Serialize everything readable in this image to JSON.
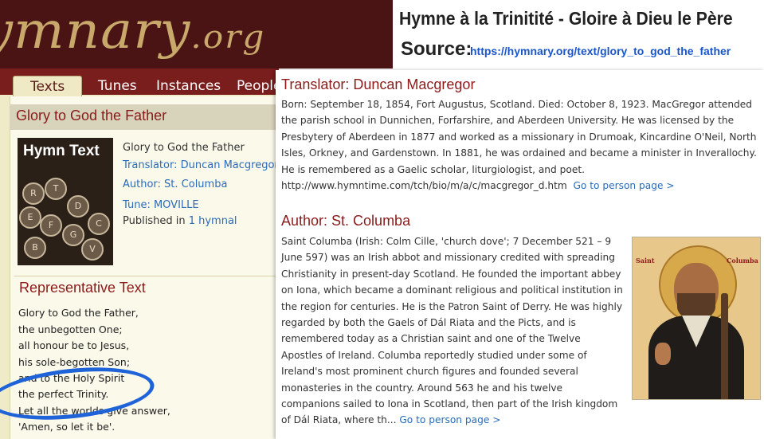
{
  "site": {
    "logo_main": "ymnary",
    "logo_suffix": ".org",
    "tabs": [
      "Texts",
      "Tunes",
      "Instances",
      "People"
    ]
  },
  "hymn": {
    "page_title": "Glory to God the Father",
    "image_caption": "Hymn Text",
    "image_keys": [
      "R",
      "T",
      "E",
      "D",
      "F",
      "G",
      "C",
      "V",
      "B"
    ],
    "info_title": "Glory to God the Father",
    "translator": "Translator: Duncan Macgregor",
    "author": "Author: St. Columba",
    "tune": "Tune: MOVILLE",
    "published_prefix": "Published in",
    "published_link": "1 hymnal"
  },
  "representative": {
    "heading": "Representative Text",
    "lines": [
      "Glory to God the Father,",
      "the unbegotten One;",
      "all honour be to Jesus,",
      "his sole-begotten Son;",
      "and to the Holy Spirit",
      "the perfect Trinity.",
      "Let all the worlds give answer,",
      "'Amen, so let it be'."
    ]
  },
  "caption": {
    "title": "Hymne à la Trinitité - Gloire à Dieu le Père",
    "source_label": "Source:",
    "source_url": "https://hymnary.org/text/glory_to_god_the_father"
  },
  "translator_bio": {
    "heading": "Translator: Duncan Macgregor",
    "text": "Born: September 18, 1854, Fort Augustus, Scotland. Died: October 8, 1923. MacGregor attended the parish school in Dunnichen, Forfarshire, and Aberdeen University. He was licensed by the Presbytery of Aberdeen in 1877 and worked as a missionary in Drumoak, Kincardine O'Neil, North Isles, Orkney, and Gardenstown. In 1881, he was ordained and became a minister in Inverallochy. He is remembered as a Gaelic scholar, liturgiologist, and poet. http://www.hymntime.com/tch/bio/m/a/c/macgregor_d.htm",
    "link": "Go to person page >"
  },
  "author_bio": {
    "heading": "Author: St. Columba",
    "text": "Saint Columba (Irish: Colm Cille, 'church dove'; 7 December 521 – 9 June 597) was an Irish abbot and missionary credited with spreading Christianity in present-day Scotland. He founded the important abbey on Iona, which became a dominant religious and political institution in the region for centuries. He is the Patron Saint of Derry. He was highly regarded by both the Gaels of Dál Riata and the Picts, and is remembered today as a Christian saint and one of the Twelve Apostles of Ireland. Columba reportedly studied under some of Ireland's most prominent church figures and founded several monasteries in the country. Around 563 he and his twelve companions sailed to Iona in Scotland, then part of the Irish kingdom of Dál Riata, where th...",
    "link": "Go to person page >",
    "icon_label_left": "Saint",
    "icon_label_right": "Columba"
  },
  "colors": {
    "header_bg": "#4a1414",
    "tabbar_bg": "#7a1d1d",
    "heading_red": "#8b1b1b",
    "link_blue": "#2a6bb8",
    "highlight_circle": "#1e63d8"
  }
}
